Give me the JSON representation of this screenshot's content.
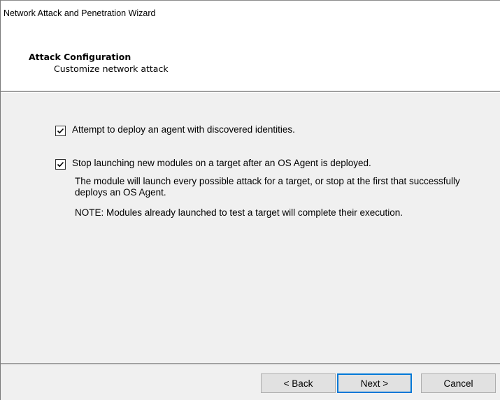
{
  "window": {
    "title": "Network Attack and Penetration Wizard"
  },
  "header": {
    "title": "Attack Configuration",
    "subtitle": "Customize network attack"
  },
  "options": [
    {
      "label": "Attempt to deploy an agent with discovered identities.",
      "checked": true
    },
    {
      "label": "Stop launching new modules on a target after an OS Agent is deployed.",
      "checked": true
    }
  ],
  "descriptions": {
    "line1": "The module will launch every possible attack for a target, or stop at the first that successfully deploys an OS Agent.",
    "line2": "NOTE: Modules already launched to test a target will complete their execution."
  },
  "buttons": {
    "back": "< Back",
    "next": "Next >",
    "cancel": "Cancel"
  }
}
